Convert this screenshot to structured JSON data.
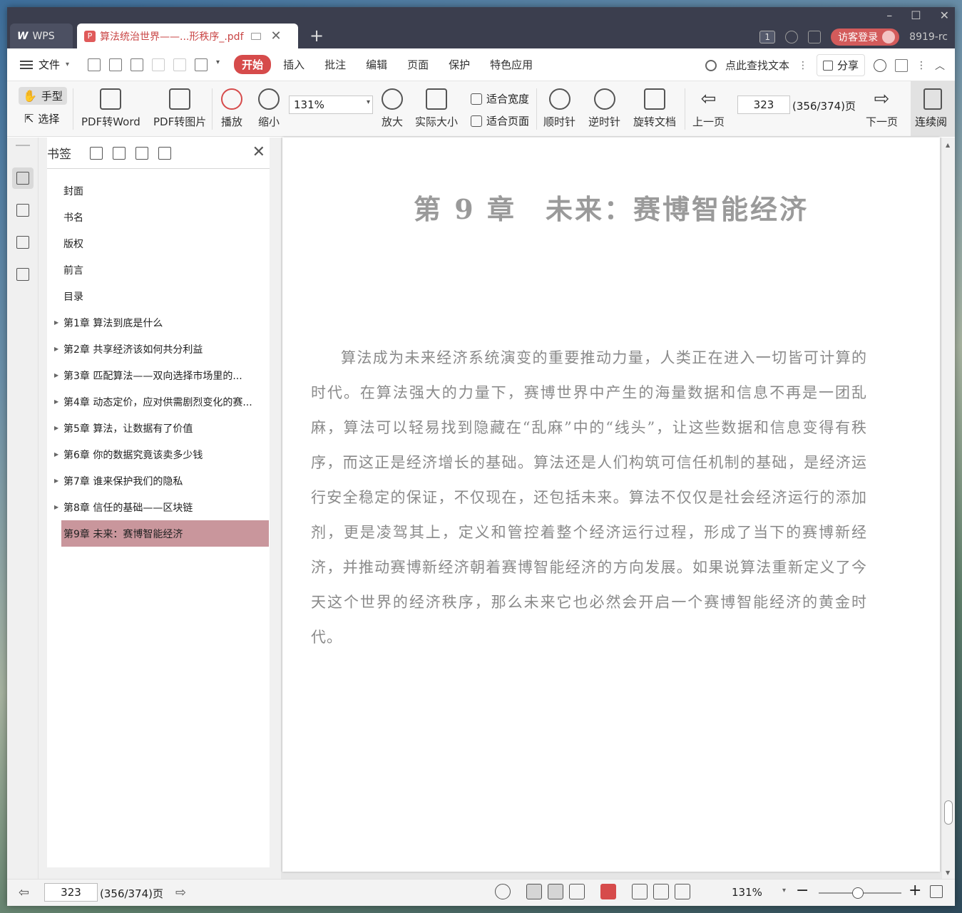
{
  "titlebar": {
    "app_tab": "WPS",
    "doc_tab": "算法统治世界——...形秩序_.pdf",
    "page_count_badge": "1",
    "login_label": "访客登录",
    "version": "8919-rc"
  },
  "menubar": {
    "file_label": "文件",
    "tabs": [
      "开始",
      "插入",
      "批注",
      "编辑",
      "页面",
      "保护",
      "特色应用"
    ],
    "search_label": "点此查找文本",
    "share_label": "分享"
  },
  "toolbar": {
    "hand": "手型",
    "select": "选择",
    "pdf_to_word": "PDF转Word",
    "pdf_to_image": "PDF转图片",
    "play": "播放",
    "zoom_out": "缩小",
    "zoom_value": "131%",
    "zoom_in": "放大",
    "actual_size": "实际大小",
    "fit_width": "适合宽度",
    "fit_page": "适合页面",
    "clockwise": "顺时针",
    "counterclockwise": "逆时针",
    "rotate_doc": "旋转文档",
    "prev_page": "上一页",
    "page_input": "323",
    "page_total": "(356/374)页",
    "next_page": "下一页",
    "continuous": "连续阅"
  },
  "bookmarks": {
    "title": "书签",
    "items": [
      {
        "label": "封面",
        "expandable": false
      },
      {
        "label": "书名",
        "expandable": false
      },
      {
        "label": "版权",
        "expandable": false
      },
      {
        "label": "前言",
        "expandable": false
      },
      {
        "label": "目录",
        "expandable": false
      },
      {
        "label": "第1章  算法到底是什么",
        "expandable": true
      },
      {
        "label": "第2章  共享经济该如何共分利益",
        "expandable": true
      },
      {
        "label": "第3章  匹配算法——双向选择市场里的...",
        "expandable": true
      },
      {
        "label": "第4章  动态定价，应对供需剧烈变化的赛...",
        "expandable": true
      },
      {
        "label": "第5章  算法，让数据有了价值",
        "expandable": true
      },
      {
        "label": "第6章  你的数据究竟该卖多少钱",
        "expandable": true
      },
      {
        "label": "第7章  谁来保护我们的隐私",
        "expandable": true
      },
      {
        "label": "第8章  信任的基础——区块链",
        "expandable": true
      },
      {
        "label": "第9章  未来：赛博智能经济",
        "expandable": true,
        "selected": true
      }
    ]
  },
  "document": {
    "chapter_title": "第 9 章　未来：赛博智能经济",
    "paragraph": "算法成为未来经济系统演变的重要推动力量，人类正在进入一切皆可计算的时代。在算法强大的力量下，赛博世界中产生的海量数据和信息不再是一团乱麻，算法可以轻易找到隐藏在“乱麻”中的“线头”，让这些数据和信息变得有秩序，而这正是经济增长的基础。算法还是人们构筑可信任机制的基础，是经济运行安全稳定的保证，不仅现在，还包括未来。算法不仅仅是社会经济运行的添加剂，更是凌驾其上，定义和管控着整个经济运行过程，形成了当下的赛博新经济，并推动赛博新经济朝着赛博智能经济的方向发展。如果说算法重新定义了今天这个世界的经济秩序，那么未来它也必然会开启一个赛博智能经济的黄金时代。"
  },
  "statusbar": {
    "page_input": "323",
    "page_total": "(356/374)页",
    "zoom": "131%",
    "zoom_fraction": 0.47
  },
  "colors": {
    "accent": "#d64b4b",
    "titlebar": "#3b3e4e",
    "selected_bookmark": "#c9969c"
  }
}
